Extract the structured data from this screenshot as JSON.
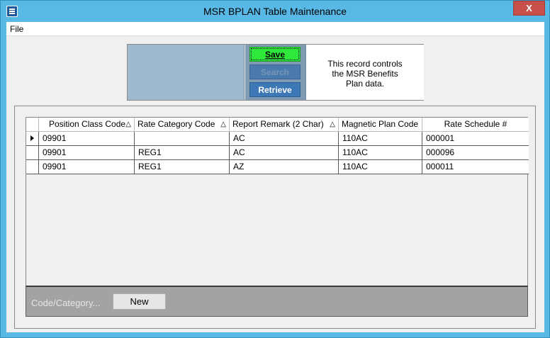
{
  "window": {
    "title": "MSR BPLAN Table Maintenance",
    "close_label": "X"
  },
  "menu": {
    "items": [
      {
        "label": "File"
      }
    ]
  },
  "toolbar": {
    "save_label": "Save",
    "search_label": "Search",
    "retrieve_label": "Retrieve",
    "info_line1": "This record controls",
    "info_line2": "the MSR Benefits",
    "info_line3": "Plan data."
  },
  "grid": {
    "columns": [
      {
        "label": "Position Class Code",
        "sort": "△"
      },
      {
        "label": "Rate Category Code",
        "sort": "△"
      },
      {
        "label": "Report Remark (2 Char)",
        "sort": "△"
      },
      {
        "label": "Magnetic Plan Code",
        "sort": ""
      },
      {
        "label": "Rate Schedule #",
        "sort": ""
      }
    ],
    "rows": [
      {
        "c0": "09901",
        "c1": "",
        "c2": "AC",
        "c3": "110AC",
        "c4": "000001",
        "current": true
      },
      {
        "c0": "09901",
        "c1": "REG1",
        "c2": "AC",
        "c3": "110AC",
        "c4": "000096",
        "current": false
      },
      {
        "c0": "09901",
        "c1": "REG1",
        "c2": "AZ",
        "c3": "110AC",
        "c4": "000011",
        "current": false
      }
    ]
  },
  "bottom": {
    "label": "Code/Category...",
    "new_label": "New"
  },
  "colors": {
    "titlebar": "#58b8e6",
    "save": "#2ee83a",
    "retrieve": "#3d78b6",
    "bottom_bar": "#a3a3a3"
  }
}
